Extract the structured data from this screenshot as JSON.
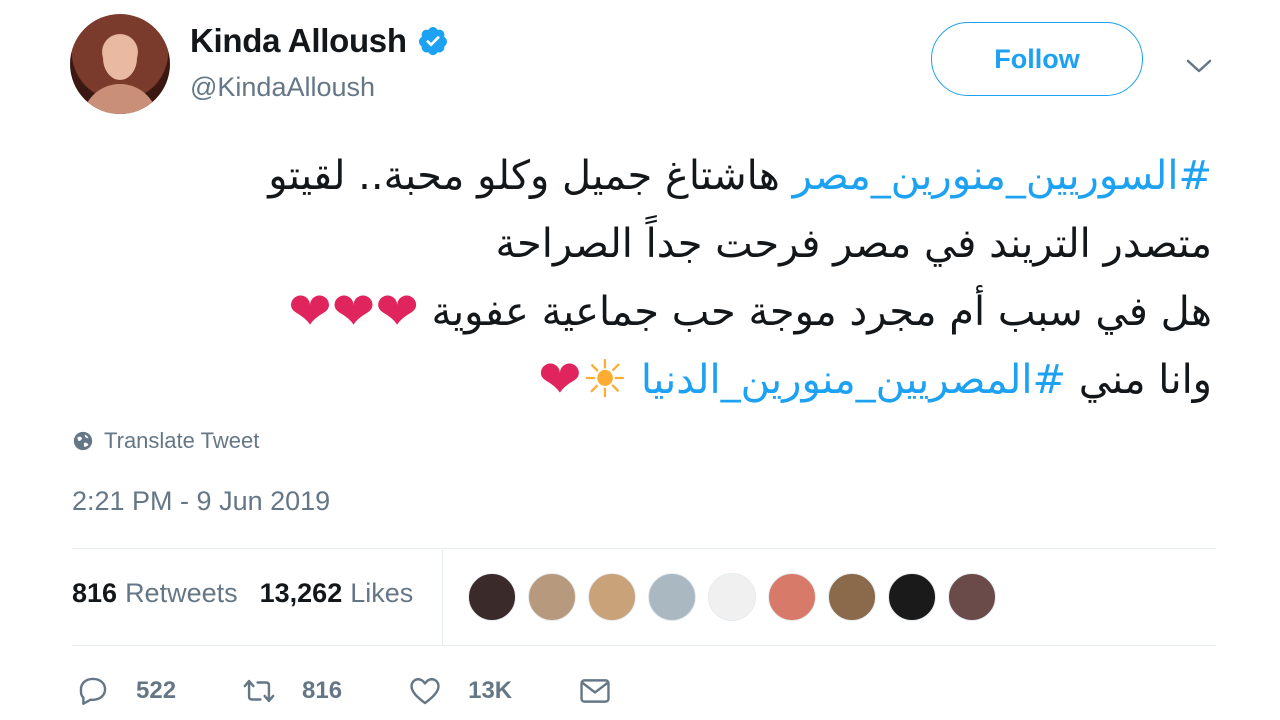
{
  "author": {
    "name": "Kinda Alloush",
    "handle": "@KindaAlloush",
    "verified": true
  },
  "follow_label": "Follow",
  "tweet": {
    "lines": [
      {
        "hashtag": "#السوريين_منورين_مصر",
        "text": " هاشتاغ جميل وكلو محبة.. لقيتو"
      },
      {
        "text": "متصدر التريند في مصر فرحت جداً الصراحة"
      },
      {
        "text": "هل في سبب أم مجرد موجة حب جماعية عفوية ",
        "emoji": "❤❤❤"
      },
      {
        "text": "وانا مني ",
        "hashtag": "#المصريين_منورين_الدنيا",
        "emoji_sun": "☀",
        "emoji_heart": "❤"
      }
    ]
  },
  "translate_label": "Translate Tweet",
  "timestamp": "2:21 PM - 9 Jun 2019",
  "stats": {
    "retweets_count": "816",
    "retweets_label": "Retweets",
    "likes_count": "13,262",
    "likes_label": "Likes"
  },
  "liker_avatars": [
    "#3a2a2a",
    "#b79a7e",
    "#c9a27a",
    "#aab8c2",
    "#f0f0f0",
    "#d87a6a",
    "#8a6a4a",
    "#1a1a1a",
    "#6b4a4a"
  ],
  "actions": {
    "reply_count": "522",
    "retweet_count": "816",
    "like_count": "13K"
  },
  "colors": {
    "accent": "#1da1f2",
    "secondary_text": "#657786",
    "heart": "#e0245e"
  }
}
